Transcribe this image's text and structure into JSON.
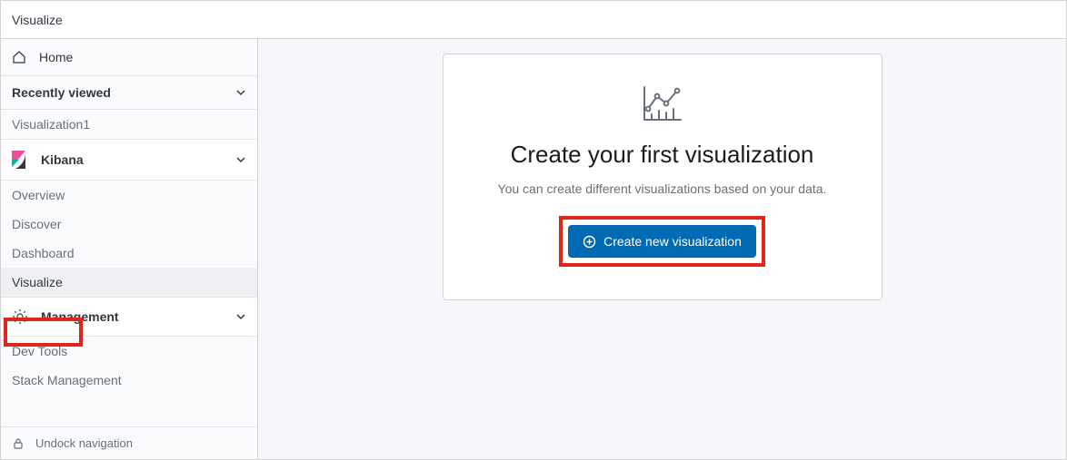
{
  "header": {
    "breadcrumb": "Visualize"
  },
  "sidebar": {
    "home_label": "Home",
    "recent_header": "Recently viewed",
    "recent_items": [
      {
        "label": "Visualization1"
      }
    ],
    "kibana_header": "Kibana",
    "kibana_items": [
      {
        "label": "Overview"
      },
      {
        "label": "Discover"
      },
      {
        "label": "Dashboard"
      },
      {
        "label": "Visualize",
        "active": true
      }
    ],
    "management_header": "Management",
    "management_items": [
      {
        "label": "Dev Tools"
      },
      {
        "label": "Stack Management"
      }
    ],
    "footer_label": "Undock navigation"
  },
  "content": {
    "title": "Create your first visualization",
    "subtitle": "You can create different visualizations based on your data.",
    "button_label": "Create new visualization"
  }
}
